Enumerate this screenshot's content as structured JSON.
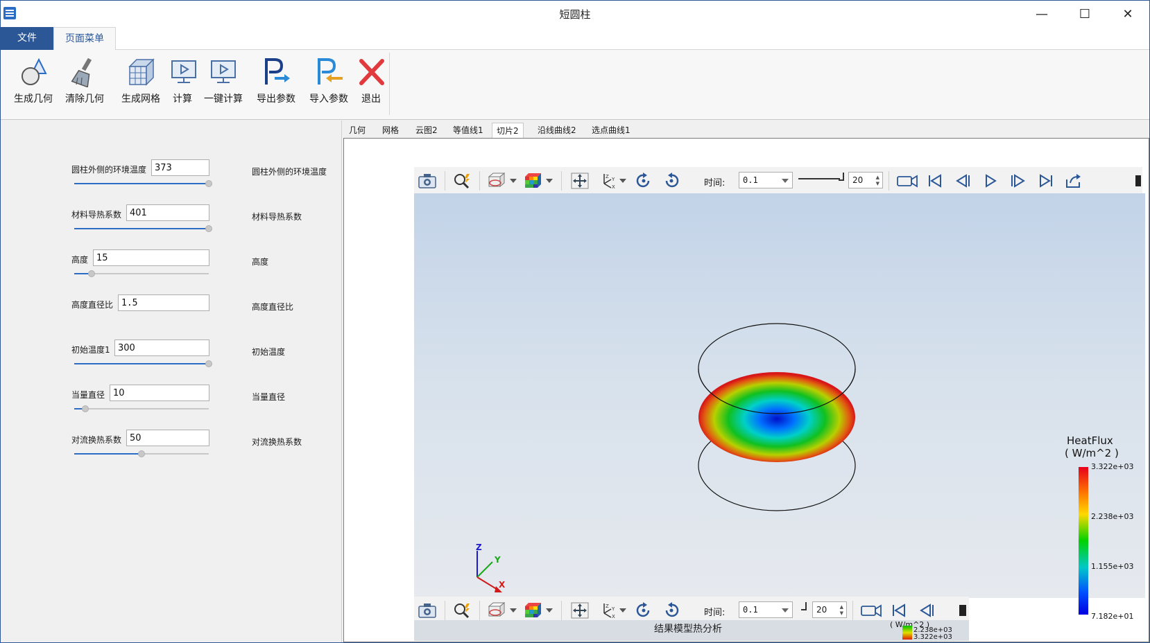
{
  "window": {
    "title": "短圆柱",
    "minimize": "—",
    "maximize": "☐",
    "close": "✕"
  },
  "ribbon_tabs": {
    "file": "文件",
    "page_menu": "页面菜单"
  },
  "ribbon": {
    "buttons": [
      {
        "label": "生成几何",
        "icon": "geometry-icon"
      },
      {
        "label": "清除几何",
        "icon": "brush-icon"
      },
      {
        "label": "生成网格",
        "icon": "mesh-icon"
      },
      {
        "label": "计算",
        "icon": "play-screen-icon"
      },
      {
        "label": "一键计算",
        "icon": "play-screen-icon"
      },
      {
        "label": "导出参数",
        "icon": "export-param-icon"
      },
      {
        "label": "导入参数",
        "icon": "import-param-icon"
      },
      {
        "label": "退出",
        "icon": "close-x-icon"
      }
    ]
  },
  "params": [
    {
      "label": "圆柱外侧的环境温度",
      "value": "373",
      "desc": "圆柱外侧的环境温度",
      "level": 1.0
    },
    {
      "label": "材料导热系数",
      "value": "401",
      "desc": "材料导热系数",
      "level": 1.0
    },
    {
      "label": "高度",
      "value": "15",
      "desc": "高度",
      "level": 0.13
    },
    {
      "label": "高度直径比",
      "value": "1.5",
      "desc": "高度直径比",
      "level": null
    },
    {
      "label": "初始温度1",
      "value": "300",
      "desc": "初始温度",
      "level": 1.0
    },
    {
      "label": "当量直径",
      "value": "10",
      "desc": "当量直径",
      "level": 0.08
    },
    {
      "label": "对流换热系数",
      "value": "50",
      "desc": "对流换热系数",
      "level": 0.5
    }
  ],
  "view_tabs": [
    "几何",
    "网格",
    "云图2",
    "等值线1",
    "切片2",
    "沿线曲线2",
    "选点曲线1"
  ],
  "active_view_tab": "切片2",
  "toolbar": {
    "time_label": "时间:",
    "time_value": "0.1",
    "frames_value": "20"
  },
  "legend": {
    "title": "HeatFlux",
    "unit": "( W/m^2 )",
    "ticks": [
      "3.322e+03",
      "2.238e+03",
      "1.155e+03",
      "7.182e+01"
    ]
  },
  "axes_triad": {
    "x": "X",
    "y": "Y",
    "z": "Z"
  },
  "bottom_overlay": {
    "label": "结果模型热分析",
    "mini_unit": "( W/m^2 )",
    "mini_ticks": [
      "2.238e+03",
      "3.322e+03"
    ]
  },
  "colors": {
    "accent": "#2b5797",
    "slider_fill": "#2b6cc4",
    "exit_red": "#e0393e"
  }
}
